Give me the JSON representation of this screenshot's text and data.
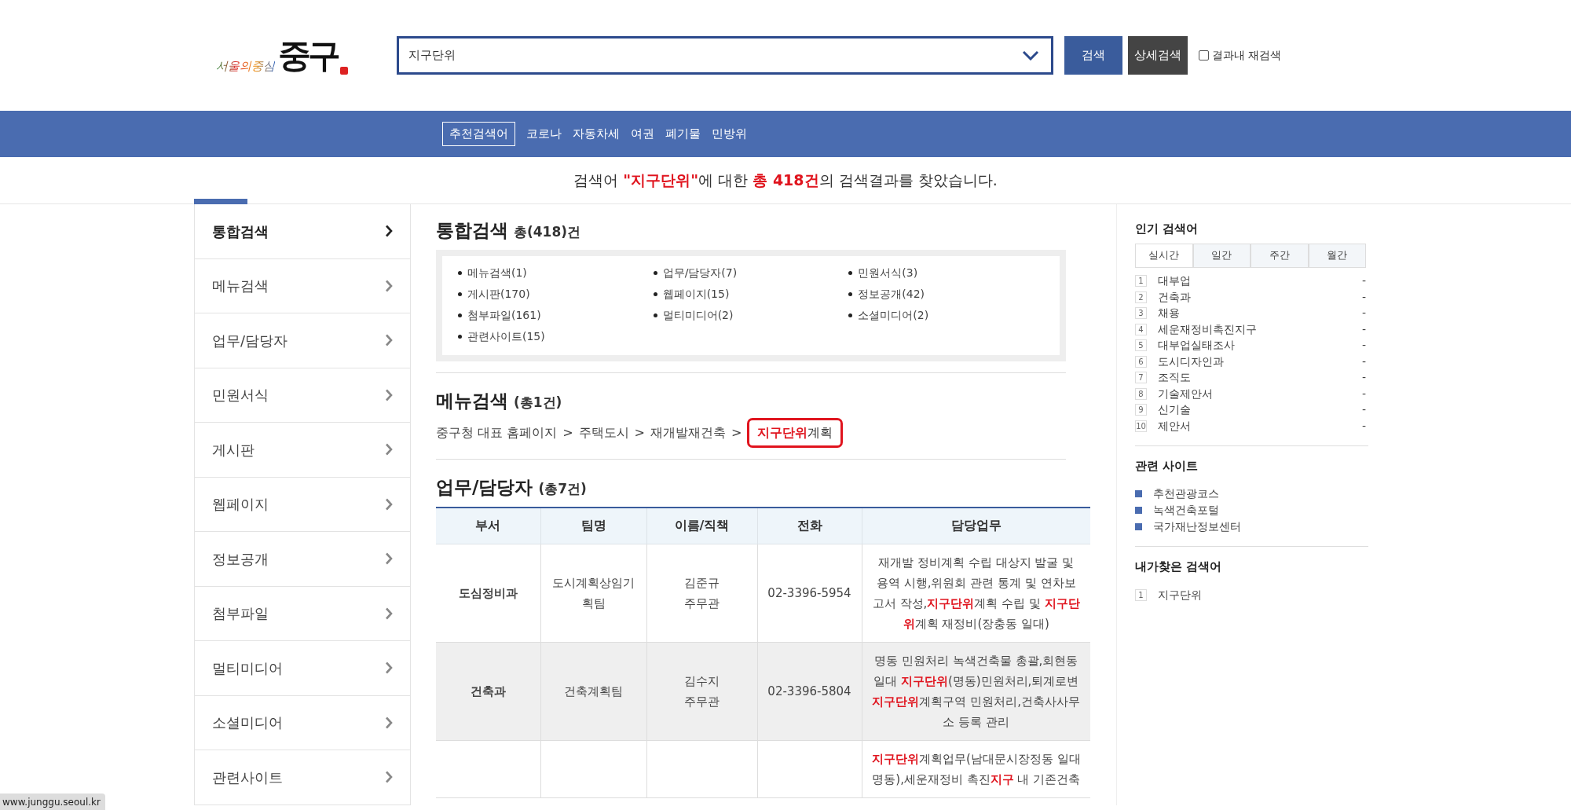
{
  "logo": {
    "small": "서울의중심",
    "large": "중구"
  },
  "search": {
    "value": "지구단위",
    "buttons": [
      "검색",
      "상세검색"
    ],
    "refine": {
      "label": "결과내 재검색",
      "checked": false
    }
  },
  "recommended": {
    "label": "추천검색어",
    "keywords": [
      "코로나",
      "자동차세",
      "여권",
      "폐기물",
      "민방위"
    ]
  },
  "result_message": "검색어 **\"지구단위\"**에 대한 **총 418건**의 검색결과를 찾았습니다.",
  "sidebar": {
    "items": [
      {
        "label": "통합검색",
        "selected": true
      },
      {
        "label": "메뉴검색",
        "selected": false
      },
      {
        "label": "업무/담당자",
        "selected": false
      },
      {
        "label": "민원서식",
        "selected": false
      },
      {
        "label": "게시판",
        "selected": false
      },
      {
        "label": "웹페이지",
        "selected": false
      },
      {
        "label": "정보공개",
        "selected": false
      },
      {
        "label": "첨부파일",
        "selected": false
      },
      {
        "label": "멀티미디어",
        "selected": false
      },
      {
        "label": "소셜미디어",
        "selected": false
      },
      {
        "label": "관련사이트",
        "selected": false
      }
    ]
  },
  "summary": {
    "title": "통합검색",
    "count": "총(418)건",
    "items": [
      "메뉴검색(1)",
      "업무/담당자(7)",
      "민원서식(3)",
      "게시판(170)",
      "웹페이지(15)",
      "정보공개(42)",
      "첨부파일(161)",
      "멀티미디어(2)",
      "소셜미디어(2)",
      "관련사이트(15)"
    ]
  },
  "menu_search": {
    "title": "메뉴검색",
    "count": "(총1건)",
    "path": [
      "중구청 대표 홈페이지",
      "주택도시",
      "재개발재건축"
    ],
    "separator": ">",
    "link": {
      "text": "**지구단위**계획",
      "focused": true
    }
  },
  "staff": {
    "title": "업무/담당자",
    "count": "(총7건)",
    "columns": [
      "부서",
      "팀명",
      "이름/직책",
      "전화",
      "담당업무"
    ],
    "rows": [
      {
        "dept": "도심정비과",
        "team": "도시계획상임기획팀",
        "name": "김준규",
        "position": "주무관",
        "phone": "02-3396-5954",
        "duties": "재개발 정비계획 수립 대상지 발굴 및 용역 시행,위원회 관련 통계 및 연차보고서 작성,**지구단위**계획 수립 및 **지구단위**계획 재정비(장충동 일대)",
        "hovered": false
      },
      {
        "dept": "건축과",
        "team": "건축계획팀",
        "name": "김수지",
        "position": "주무관",
        "phone": "02-3396-5804",
        "duties": "명동 민원처리 녹색건축물 총괄,회현동 일대 **지구단위**(명동)민원처리,퇴계로변 **지구단위**계획구역 민원처리,건축사사무소 등록 관리",
        "hovered": true
      },
      {
        "duties": "**지구단위**계획업무(남대문시장정동 일대 명동),세운재정비 촉진**지구** 내 기존건축",
        "hovered": false
      }
    ]
  },
  "popular": {
    "title": "인기 검색어",
    "tabs": [
      {
        "label": "실시간",
        "selected": true
      },
      {
        "label": "일간",
        "selected": false
      },
      {
        "label": "주간",
        "selected": false
      },
      {
        "label": "월간",
        "selected": false
      }
    ],
    "items": [
      {
        "rank": "1",
        "keyword": "대부업",
        "change": "-"
      },
      {
        "rank": "2",
        "keyword": "건축과",
        "change": "-"
      },
      {
        "rank": "3",
        "keyword": "채용",
        "change": "-"
      },
      {
        "rank": "4",
        "keyword": "세운재정비촉진지구",
        "change": "-"
      },
      {
        "rank": "5",
        "keyword": "대부업실태조사",
        "change": "-"
      },
      {
        "rank": "6",
        "keyword": "도시디자인과",
        "change": "-"
      },
      {
        "rank": "7",
        "keyword": "조직도",
        "change": "-"
      },
      {
        "rank": "8",
        "keyword": "기술제안서",
        "change": "-"
      },
      {
        "rank": "9",
        "keyword": "신기술",
        "change": "-"
      },
      {
        "rank": "10",
        "keyword": "제안서",
        "change": "-"
      }
    ]
  },
  "related_sites": {
    "title": "관련 사이트",
    "items": [
      "추천관광코스",
      "녹색건축포털",
      "국가재난정보센터"
    ]
  },
  "my_searches": {
    "title": "내가찾은 검색어",
    "items": [
      {
        "rank": "1",
        "keyword": "지구단위"
      }
    ]
  },
  "status_url": "www.junggu.seoul.kr"
}
